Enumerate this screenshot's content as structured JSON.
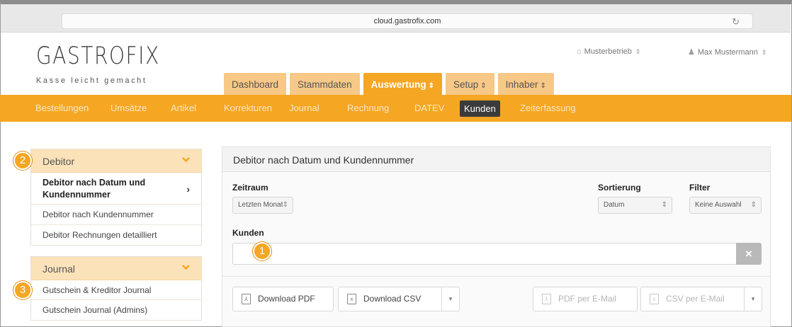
{
  "browser": {
    "url": "cloud.gastrofix.com"
  },
  "header": {
    "logo": "GASTROFIX",
    "tagline": "Kasse leicht gemacht",
    "business": "Musterbetrieb",
    "user": "Max Mustermann"
  },
  "tabs": [
    {
      "label": "Dashboard"
    },
    {
      "label": "Stammdaten"
    },
    {
      "label": "Auswertung"
    },
    {
      "label": "Setup"
    },
    {
      "label": "Inhaber"
    }
  ],
  "subnav": [
    {
      "label": "Bestellungen"
    },
    {
      "label": "Umsätze"
    },
    {
      "label": "Artikel"
    },
    {
      "label": "Korrekturen"
    },
    {
      "label": "Journal"
    },
    {
      "label": "Rechnung"
    },
    {
      "label": "DATEV"
    },
    {
      "label": "Kunden"
    },
    {
      "label": "Zeiterfassung"
    }
  ],
  "sidebar": {
    "debitor": {
      "title": "Debitor",
      "items": [
        {
          "label": "Debitor nach Datum und Kundennummer"
        },
        {
          "label": "Debitor nach Kundennummer"
        },
        {
          "label": "Debitor Rechnungen detailliert"
        }
      ]
    },
    "journal": {
      "title": "Journal",
      "items": [
        {
          "label": "Gutschein & Kreditor Journal"
        },
        {
          "label": "Gutschein Journal (Admins)"
        }
      ]
    }
  },
  "badges": [
    "1",
    "2",
    "3"
  ],
  "main": {
    "title": "Debitor nach Datum und Kundennummer",
    "zeitraum_label": "Zeitraum",
    "zeitraum_value": "Letzten Monat",
    "sortierung_label": "Sortierung",
    "sortierung_value": "Datum",
    "filter_label": "Filter",
    "filter_value": "Keine Auswahl",
    "kunden_label": "Kunden",
    "clear_label": "×",
    "buttons": {
      "download_pdf": "Download PDF",
      "download_csv": "Download CSV",
      "pdf_mail": "PDF per E-Mail",
      "csv_mail": "CSV per E-Mail"
    }
  },
  "colors": {
    "accent": "#f5a623",
    "tab_inactive": "#f7c886",
    "panel_head": "#fbe2b9",
    "active_subnav": "#3b3b3b"
  }
}
